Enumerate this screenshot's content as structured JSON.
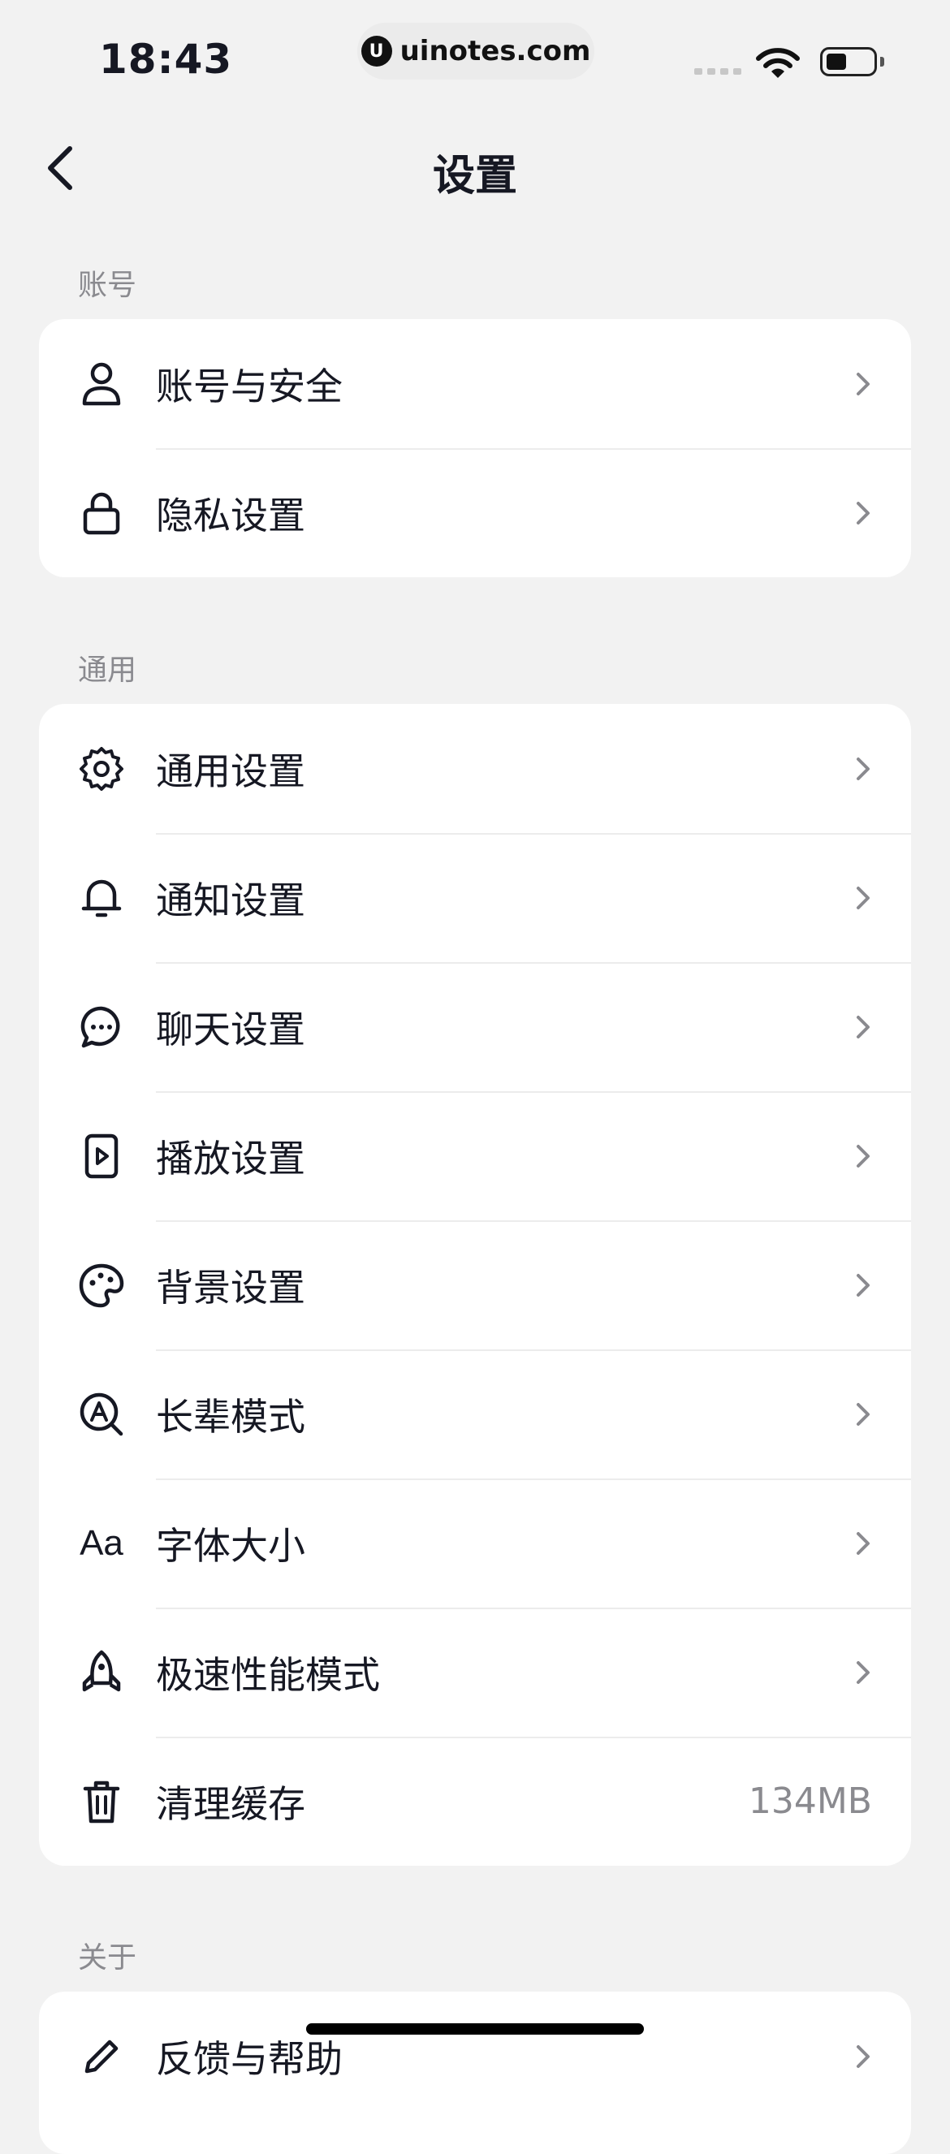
{
  "status_bar": {
    "time": "18:43",
    "url": "uinotes.com",
    "logo_letter": "U"
  },
  "header": {
    "title": "设置"
  },
  "sections": [
    {
      "label": "账号",
      "items": [
        {
          "label": "账号与安全",
          "icon": "person-icon"
        },
        {
          "label": "隐私设置",
          "icon": "lock-icon"
        }
      ]
    },
    {
      "label": "通用",
      "items": [
        {
          "label": "通用设置",
          "icon": "gear-icon"
        },
        {
          "label": "通知设置",
          "icon": "bell-icon"
        },
        {
          "label": "聊天设置",
          "icon": "chat-bubble-icon"
        },
        {
          "label": "播放设置",
          "icon": "play-icon"
        },
        {
          "label": "背景设置",
          "icon": "palette-icon"
        },
        {
          "label": "长辈模式",
          "icon": "elder-mode-icon"
        },
        {
          "label": "字体大小",
          "icon": "font-size-icon",
          "icon_text": "Aa"
        },
        {
          "label": "极速性能模式",
          "icon": "rocket-icon"
        },
        {
          "label": "清理缓存",
          "icon": "trash-icon",
          "value": "134MB"
        }
      ]
    },
    {
      "label": "关于",
      "items": [
        {
          "label": "反馈与帮助",
          "icon": "edit-icon"
        }
      ]
    }
  ]
}
